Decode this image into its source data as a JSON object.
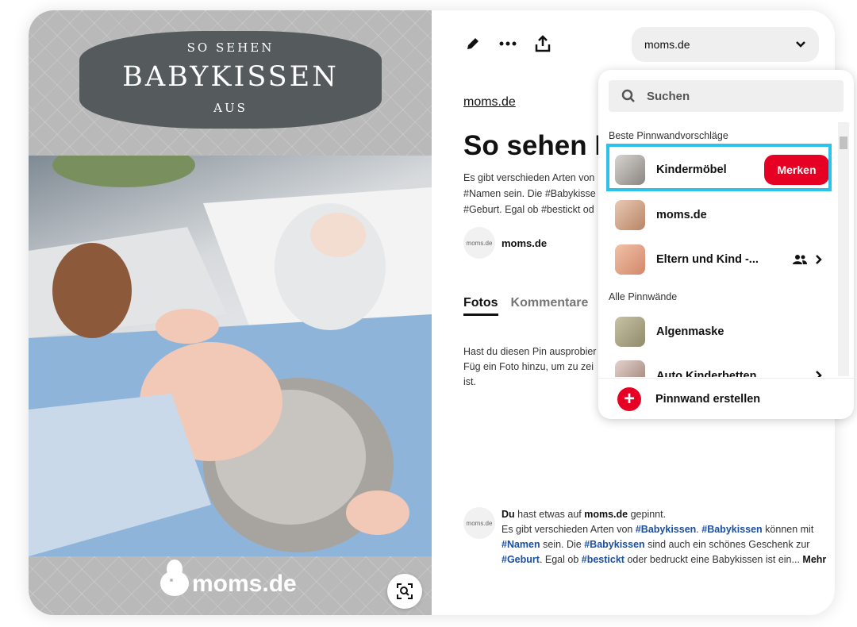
{
  "image": {
    "banner_top": "SO SEHEN",
    "banner_main": "BABYKISSEN",
    "banner_bottom": "AUS",
    "watermark": "moms.de"
  },
  "toolbar": {
    "edit_icon": "pencil-icon",
    "more_icon": "ellipsis-icon",
    "share_icon": "share-icon",
    "board_select_value": "moms.de"
  },
  "pin": {
    "source_link": "moms.de",
    "title": "So sehen B",
    "description": "Es gibt verschieden Arten von #Namen sein. Die #Babykisse #Geburt. Egal ob #bestickt od",
    "author_name": "moms.de",
    "author_avatar_text": "moms.de"
  },
  "tabs": [
    {
      "label": "Fotos"
    },
    {
      "label": "Kommentare"
    }
  ],
  "comments_empty": "Hast du diesen Pin ausprobier Füg ein Foto hinzu, um zu zei ist.",
  "activity": {
    "user": "Du",
    "text_1": " hast etwas auf ",
    "board": "moms.de",
    "text_2": " gepinnt.",
    "line_a": "Es gibt verschieden Arten von ",
    "tag_1": "#Babykissen",
    "sep_1": ". ",
    "tag_2": "#Babykissen",
    "line_b": " können mit ",
    "tag_3": "#Namen",
    "line_c": " sein. Die ",
    "tag_4": "#Babykissen",
    "line_d": " sind auch ein schönes Geschenk zur ",
    "tag_5": "#Geburt",
    "line_e": ". Egal ob ",
    "tag_6": "#bestickt",
    "line_f": " oder bedruckt eine Babykissen ist ein... ",
    "more": "Mehr"
  },
  "dropdown": {
    "search_placeholder": "Suchen",
    "section_suggested": "Beste Pinnwandvorschläge",
    "section_all": "Alle Pinnwände",
    "save_label": "Merken",
    "create_label": "Pinnwand erstellen",
    "boards_suggested": [
      {
        "name": "Kindermöbel"
      },
      {
        "name": "moms.de"
      },
      {
        "name": "Eltern und Kind -..."
      }
    ],
    "boards_all": [
      {
        "name": "Algenmaske"
      },
      {
        "name": "Auto Kinderbetten"
      }
    ]
  }
}
